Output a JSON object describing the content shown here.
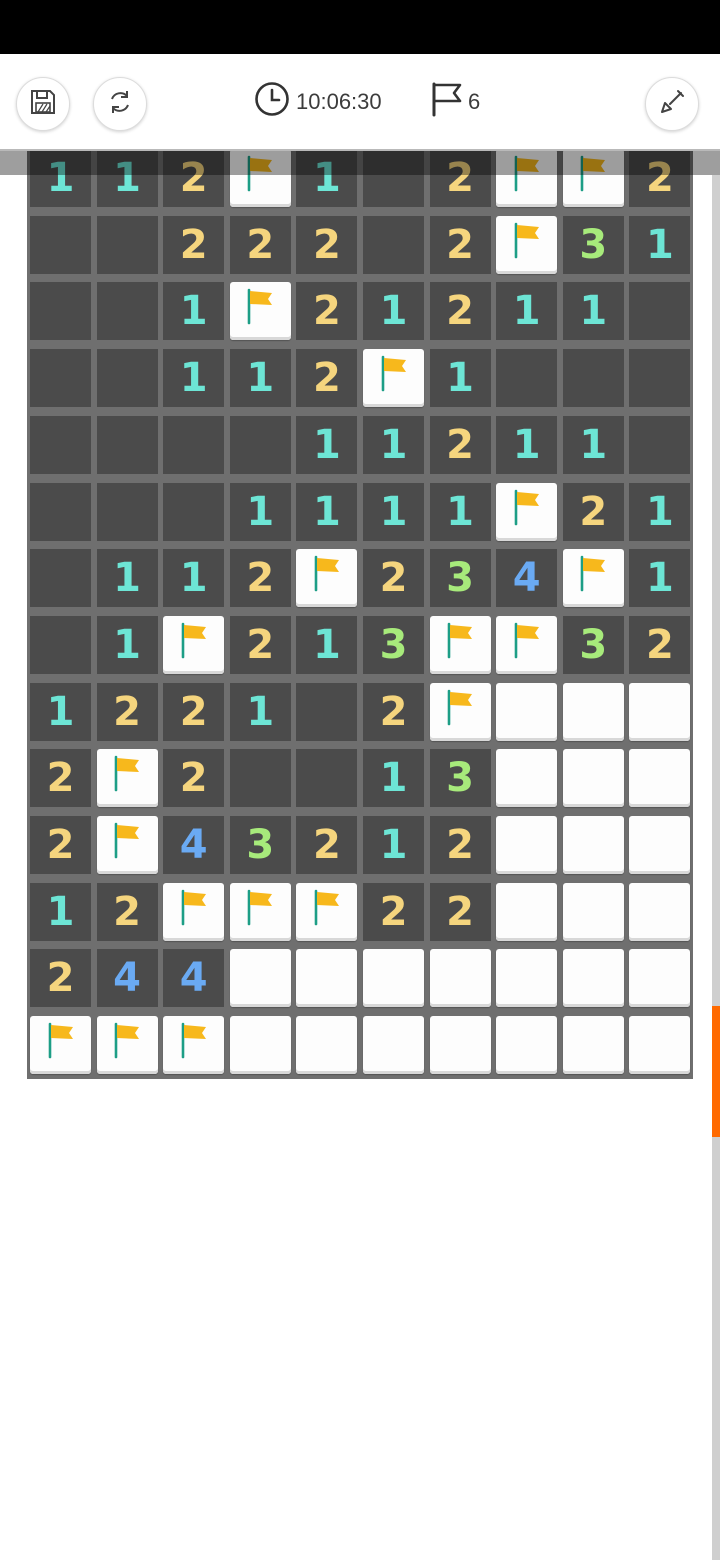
{
  "toolbar": {
    "save_icon": "floppy-disk-icon",
    "restart_icon": "refresh-icon",
    "timer_icon": "clock-icon",
    "timer": "10:06:30",
    "flag_icon": "flag-outline-icon",
    "flags": "6",
    "dig_icon": "shovel-icon"
  },
  "colors": {
    "1": "#6de5d5",
    "2": "#f5d57e",
    "3": "#a7ea7b",
    "4": "#6aaaf3",
    "flag": "#f7b81c",
    "pole": "#1d9e86"
  },
  "board": {
    "rows": [
      [
        "1",
        "1",
        "2",
        "F",
        "1",
        "",
        "2",
        "F",
        "F",
        "2"
      ],
      [
        "",
        "",
        "2",
        "2",
        "2",
        "",
        "2",
        "F",
        "3",
        "1"
      ],
      [
        "",
        "",
        "1",
        "F",
        "2",
        "1",
        "2",
        "1",
        "1",
        ""
      ],
      [
        "",
        "",
        "1",
        "1",
        "2",
        "F",
        "1",
        "",
        "",
        ""
      ],
      [
        "",
        "",
        "",
        "",
        "1",
        "1",
        "2",
        "1",
        "1",
        ""
      ],
      [
        "",
        "",
        "",
        "1",
        "1",
        "1",
        "1",
        "F",
        "2",
        "1"
      ],
      [
        "",
        "1",
        "1",
        "2",
        "F",
        "2",
        "3",
        "4",
        "F",
        "1"
      ],
      [
        "",
        "1",
        "F",
        "2",
        "1",
        "3",
        "F",
        "F",
        "3",
        "2"
      ],
      [
        "1",
        "2",
        "2",
        "1",
        "",
        "2",
        "F",
        "H",
        "H",
        "H"
      ],
      [
        "2",
        "F",
        "2",
        "",
        "",
        "1",
        "3",
        "H",
        "H",
        "H"
      ],
      [
        "2",
        "F",
        "4",
        "3",
        "2",
        "1",
        "2",
        "H",
        "H",
        "H"
      ],
      [
        "1",
        "2",
        "F",
        "F",
        "F",
        "2",
        "2",
        "H",
        "H",
        "H"
      ],
      [
        "2",
        "4",
        "4",
        "H",
        "H",
        "H",
        "H",
        "H",
        "H",
        "H"
      ],
      [
        "F",
        "F",
        "F",
        "H",
        "H",
        "H",
        "H",
        "H",
        "H",
        "H"
      ]
    ]
  }
}
